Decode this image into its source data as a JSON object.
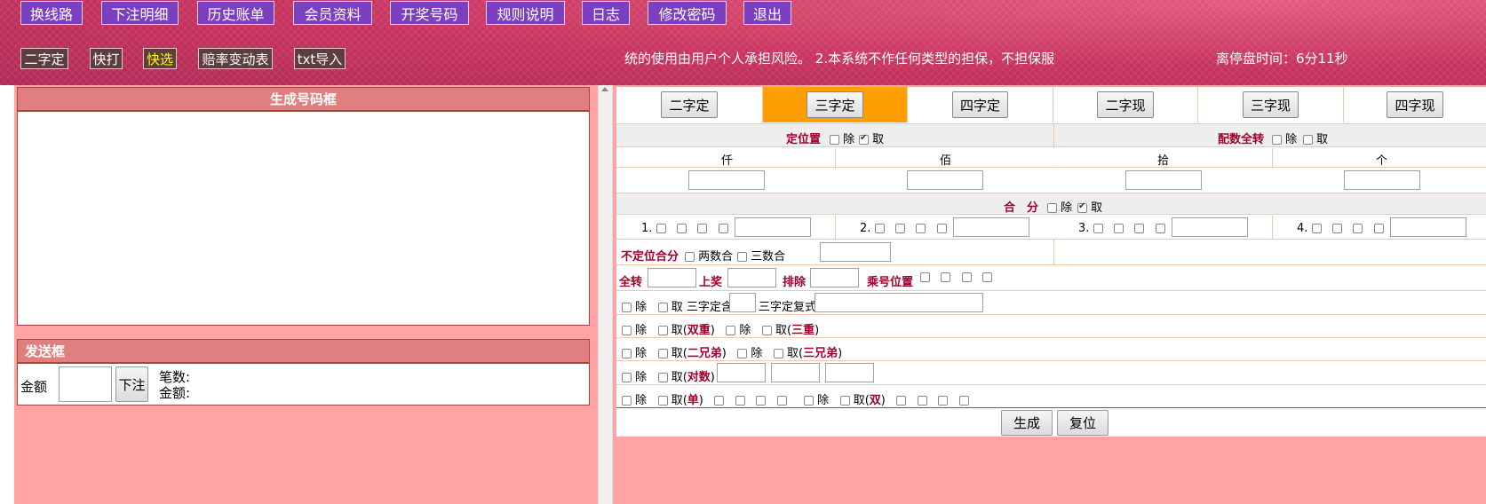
{
  "nav": [
    "换线路",
    "下注明细",
    "历史账单",
    "会员资料",
    "开奖号码",
    "规则说明",
    "日志",
    "修改密码",
    "退出"
  ],
  "subnav": [
    "二字定",
    "快打",
    "快选",
    "赔率变动表",
    "txt导入"
  ],
  "marquee": "统的使用由用户个人承担风险。 2.本系统不作任何类型的担保，不担保服",
  "timer": "离停盘时间：6分11秒",
  "left": {
    "gen_title": "生成号码框",
    "send_title": "发送框",
    "amount_label": "金额",
    "bet_button": "下注",
    "count_label": "笔数:",
    "total_label": "金额:"
  },
  "tabs": [
    "二字定",
    "三字定",
    "四字定",
    "二字现",
    "三字现",
    "四字现"
  ],
  "active_tab": "三字定",
  "form": {
    "position_label": "定位置",
    "exclude": "除",
    "take": "取",
    "pair_label": "配数全转",
    "cols": [
      "仟",
      "佰",
      "拾",
      "个"
    ],
    "hefen_label": "合　分",
    "hefen_nums": [
      "1.",
      "2.",
      "3.",
      "4."
    ],
    "budingwei_label": "不定位合分",
    "two_num": "两数合",
    "three_num": "三数合",
    "quanzhuan": "全转",
    "shangjiang": "上奖",
    "paichu": "排除",
    "chenghao": "乘号位置",
    "sanzidinghan": "三字定含",
    "sanzidingfushi": "三字定复式",
    "shuangchong": "双重",
    "sanchong": "三重",
    "erxiongdi": "二兄弟",
    "sanxiongdi": "三兄弟",
    "duishu": "对数",
    "dan": "单",
    "shuang": "双",
    "take_paren": "取(",
    "close_paren": ")",
    "generate": "生成",
    "reset": "复位"
  }
}
